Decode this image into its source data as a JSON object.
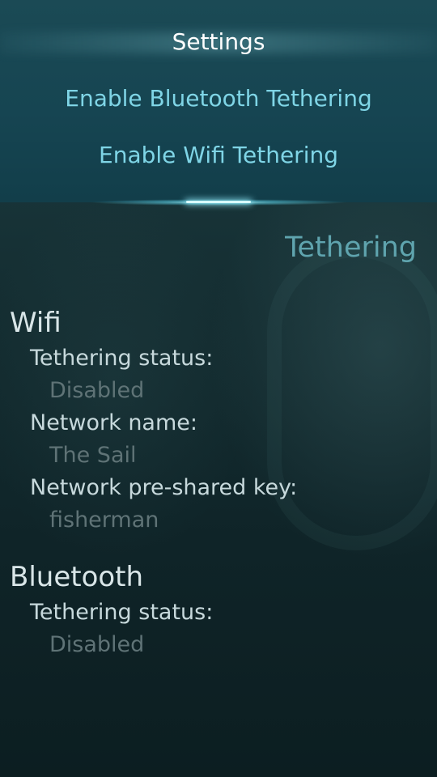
{
  "pulley_menu": {
    "items": [
      {
        "label": "Settings"
      },
      {
        "label": "Enable Bluetooth Tethering"
      },
      {
        "label": "Enable Wifi Tethering"
      }
    ]
  },
  "page": {
    "title": "Tethering"
  },
  "wifi": {
    "title": "Wifi",
    "status_label": "Tethering status:",
    "status_value": "Disabled",
    "network_name_label": "Network name:",
    "network_name_value": "The Sail",
    "psk_label": "Network pre-shared key:",
    "psk_value": "fisherman"
  },
  "bluetooth": {
    "title": "Bluetooth",
    "status_label": "Tethering status:",
    "status_value": "Disabled"
  },
  "colors": {
    "highlight": "#7fd5e6",
    "header": "#5fa4ae",
    "primary_text": "#d9e6e8",
    "secondary_text": "#5f7376"
  }
}
